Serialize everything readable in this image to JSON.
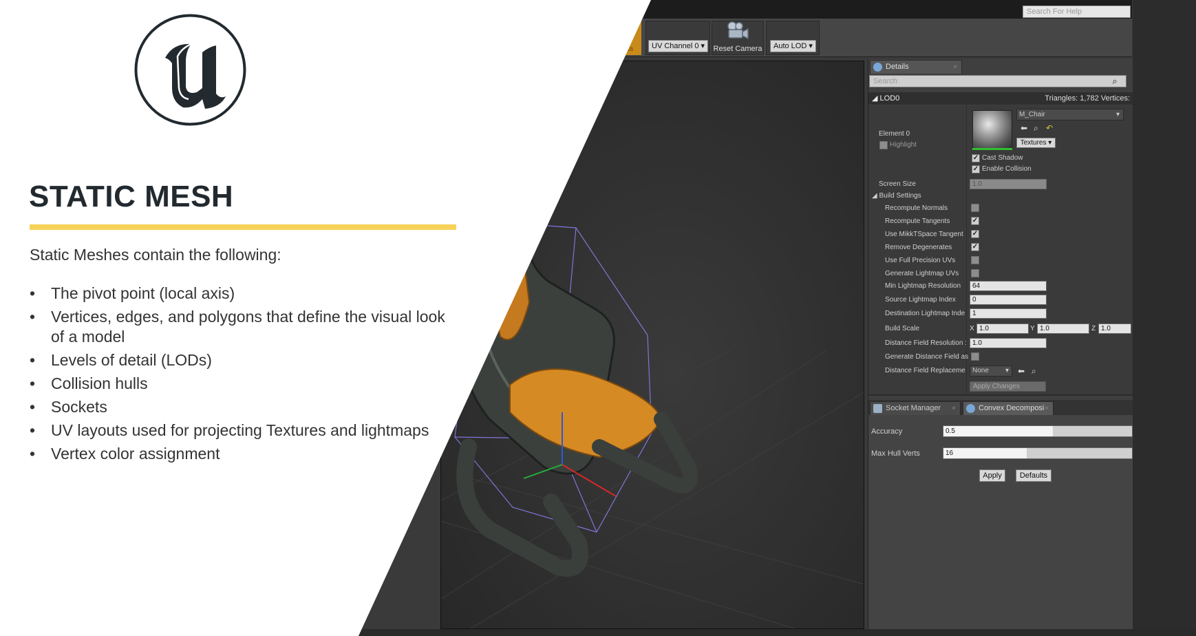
{
  "editor": {
    "help_search_placeholder": "Search For Help",
    "toolbar": {
      "orange_button_label": "ata",
      "uv_channel": "UV Channel 0",
      "reset_camera": "Reset Camera",
      "auto_lod": "Auto LOD"
    }
  },
  "details": {
    "tab_label": "Details",
    "search_placeholder": "Search",
    "lod_header": "LOD0",
    "lod_stats": "Triangles: 1,782   Vertices:",
    "element_label": "Element 0",
    "highlight_label": "Highlight",
    "material_name": "M_Chair",
    "textures_button": "Textures",
    "cast_shadow": "Cast Shadow",
    "enable_collision": "Enable Collision",
    "screen_size_label": "Screen Size",
    "screen_size_value": "1.0",
    "build_settings_label": "Build Settings",
    "build_settings": [
      {
        "label": "Recompute Normals",
        "checked": false
      },
      {
        "label": "Recompute Tangents",
        "checked": true
      },
      {
        "label": "Use MikkTSpace Tangent",
        "checked": true
      },
      {
        "label": "Remove Degenerates",
        "checked": true
      },
      {
        "label": "Use Full Precision UVs",
        "checked": false
      },
      {
        "label": "Generate Lightmap UVs",
        "checked": false
      }
    ],
    "min_lightmap_resolution_label": "Min Lightmap Resolution",
    "min_lightmap_resolution_value": "64",
    "source_lightmap_index_label": "Source Lightmap Index",
    "source_lightmap_index_value": "0",
    "destination_lightmap_index_label": "Destination Lightmap Inde",
    "destination_lightmap_index_value": "1",
    "build_scale_label": "Build Scale",
    "build_scale": {
      "x_label": "X",
      "x": "1.0",
      "y_label": "Y",
      "y": "1.0",
      "z_label": "Z",
      "z": "1.0"
    },
    "distance_field_resolution_label": "Distance Field Resolution :",
    "distance_field_resolution_value": "1.0",
    "generate_distance_field_label": "Generate Distance Field as",
    "distance_field_replacement_label": "Distance Field Replaceme",
    "distance_field_replacement_value": "None",
    "apply_changes_button": "Apply Changes"
  },
  "convex": {
    "socket_manager_tab": "Socket Manager",
    "convex_tab": "Convex Decomposi",
    "accuracy_label": "Accuracy",
    "accuracy_value": "0.5",
    "accuracy_fill": 0.58,
    "max_hull_verts_label": "Max Hull Verts",
    "max_hull_verts_value": "16",
    "max_hull_verts_fill": 0.44,
    "apply_button": "Apply",
    "defaults_button": "Defaults"
  },
  "slide": {
    "title": "STATIC MESH",
    "intro": "Static Meshes contain the following:",
    "bullet_char": "•",
    "bullets": [
      "The pivot point (local axis)",
      "Vertices, edges, and polygons that define the visual look of a model",
      "Levels of detail (LODs)",
      "Collision hulls",
      "Sockets",
      "UV layouts used for projecting Textures and lightmaps",
      "Vertex color assignment"
    ],
    "accent_color": "#f7d25a",
    "logo_icon": "unreal-engine-logo"
  }
}
